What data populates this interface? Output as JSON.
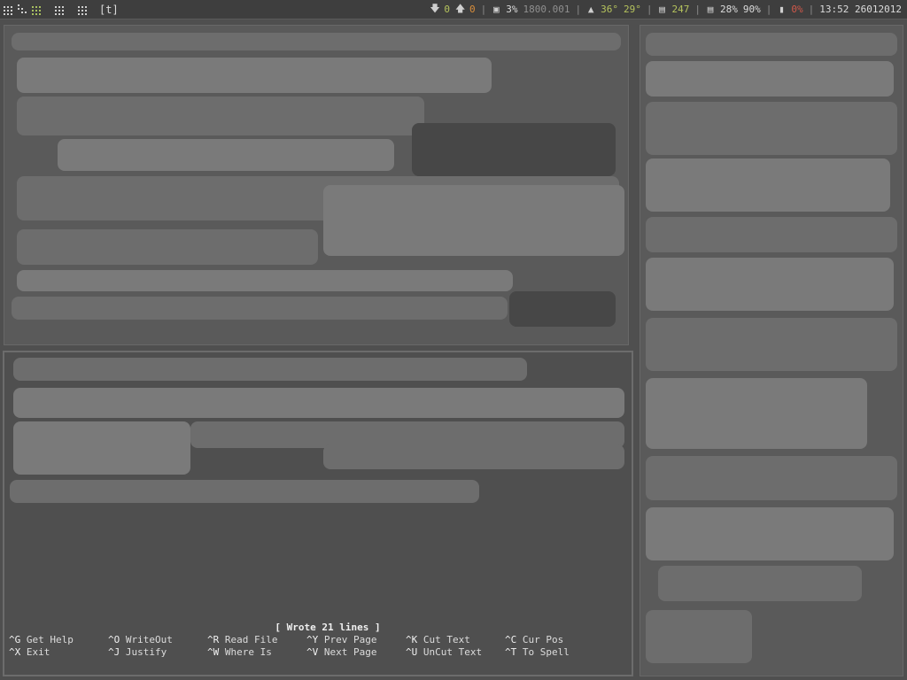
{
  "topbar": {
    "layout_label": "[t]",
    "download": "0",
    "upload": "0",
    "cpu_percent": "3%",
    "cpu_freq": "1800.001",
    "temp1": "36°",
    "temp2": "29°",
    "mem": "247",
    "disk1": "28%",
    "disk2": "90%",
    "battery": "0%",
    "clock": "13:52 26012012"
  },
  "nano": {
    "status_message": "[ Wrote 21 lines ]",
    "row1": [
      {
        "key": "^G",
        "label": " Get Help"
      },
      {
        "key": "^O",
        "label": " WriteOut"
      },
      {
        "key": "^R",
        "label": " Read File"
      },
      {
        "key": "^Y",
        "label": " Prev Page"
      },
      {
        "key": "^K",
        "label": " Cut Text"
      },
      {
        "key": "^C",
        "label": " Cur Pos"
      }
    ],
    "row2": [
      {
        "key": "^X",
        "label": " Exit"
      },
      {
        "key": "^J",
        "label": " Justify"
      },
      {
        "key": "^W",
        "label": " Where Is"
      },
      {
        "key": "^V",
        "label": " Next Page"
      },
      {
        "key": "^U",
        "label": " UnCut Text"
      },
      {
        "key": "^T",
        "label": " To Spell"
      }
    ]
  },
  "colors": {
    "bar_bg": "#3e3e3e",
    "accent_green": "#b5c35d",
    "accent_orange": "#d98e3b",
    "accent_red": "#d0584a"
  }
}
